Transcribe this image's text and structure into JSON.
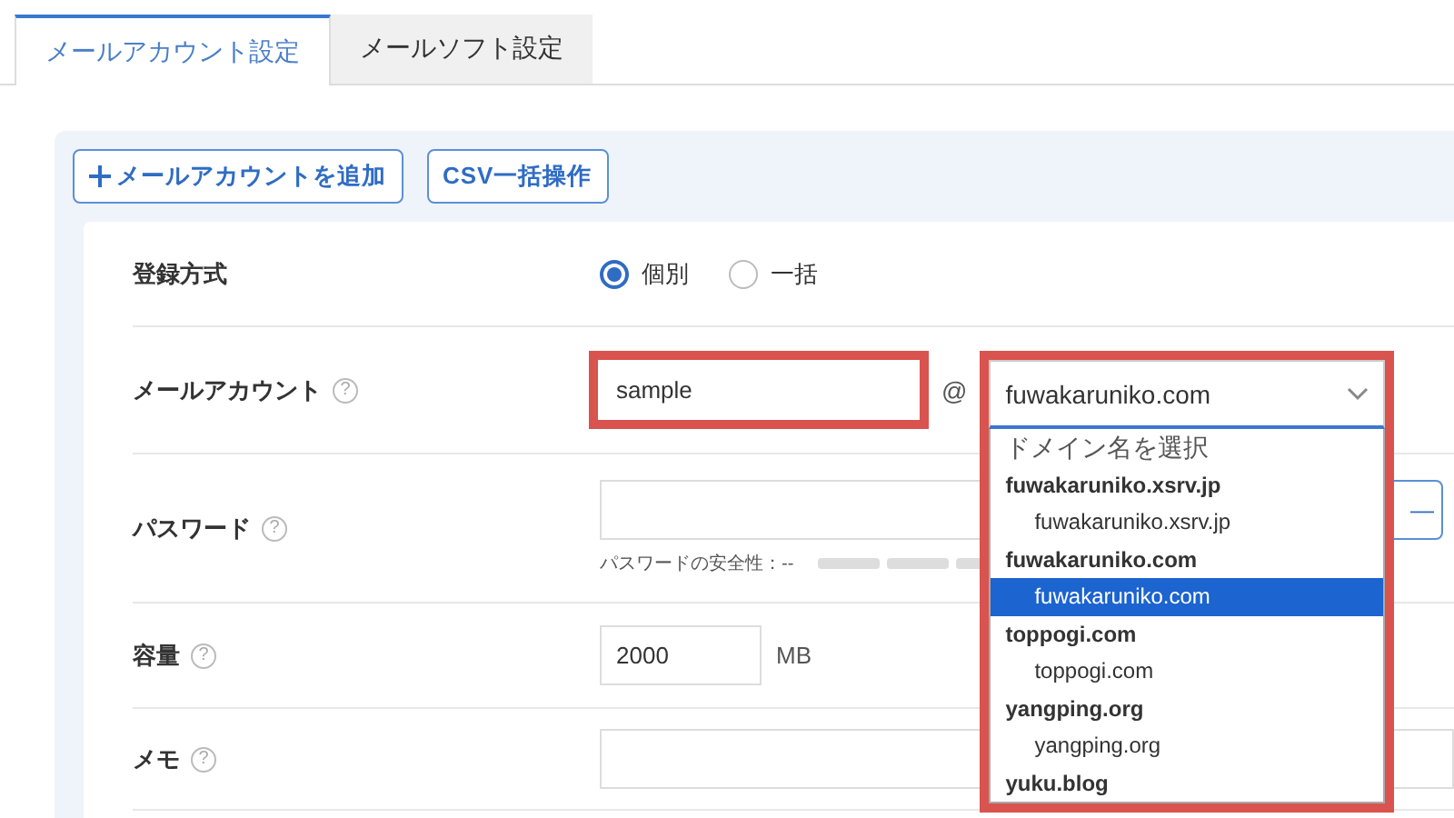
{
  "tabs": [
    {
      "label": "メールアカウント設定",
      "selected": true
    },
    {
      "label": "メールソフト設定",
      "selected": false
    }
  ],
  "toolbar": {
    "buttons": [
      {
        "label": "メールアカウントを追加",
        "kind": "add"
      },
      {
        "label": "CSV一括操作",
        "kind": "plain"
      }
    ]
  },
  "form": {
    "rows": [
      {
        "kind": "radio",
        "label": "登録方式",
        "options": [
          {
            "label": "個別",
            "selected": true
          },
          {
            "label": "一括",
            "selected": false
          }
        ]
      },
      {
        "kind": "account",
        "label": "メールアカウント",
        "help_icon": "?",
        "local_part": {
          "value": "sample",
          "highlighted": true
        },
        "at": "@",
        "domain": {
          "value": "fuwakaruniko.com",
          "highlighted": true,
          "expanded": true,
          "prompt": "ドメイン名を選択",
          "groups": [
            {
              "label": "fuwakaruniko.xsrv.jp",
              "options": [
                {
                  "label": "fuwakaruniko.xsrv.jp",
                  "selected": false
                }
              ]
            },
            {
              "label": "fuwakaruniko.com",
              "options": [
                {
                  "label": "fuwakaruniko.com",
                  "selected": true
                }
              ]
            },
            {
              "label": "toppogi.com",
              "options": [
                {
                  "label": "toppogi.com",
                  "selected": false
                }
              ]
            },
            {
              "label": "yangping.org",
              "options": [
                {
                  "label": "yangping.org",
                  "selected": false
                }
              ]
            },
            {
              "label": "yuku.blog"
            }
          ]
        }
      },
      {
        "kind": "password",
        "label": "パスワード",
        "help_icon": "?",
        "button_text": "—",
        "strength_label": "パスワードの安全性：--"
      },
      {
        "kind": "capacity",
        "label": "容量",
        "help_icon": "?",
        "value": "2000",
        "unit": "MB"
      },
      {
        "kind": "memo",
        "label": "メモ",
        "help_icon": "?"
      }
    ]
  }
}
